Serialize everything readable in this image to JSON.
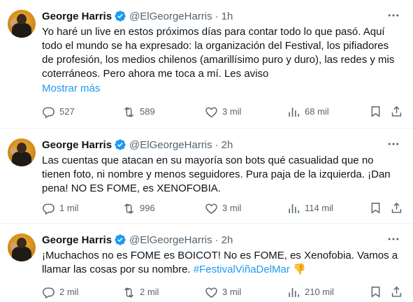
{
  "tweets": [
    {
      "name": "George Harris",
      "handle": "@ElGeorgeHarris",
      "separator": "·",
      "time": "1h",
      "text_lines": [
        "Yo haré un live en estos próximos días para contar todo lo que pasó. Aquí",
        "todo el mundo se ha expresado: la organización del Festival, los pifiadores",
        "de profesión, los medios chilenos (amarillísimo puro y duro), las redes y mis",
        "coterráneos. Pero ahora me toca a mí. Les aviso"
      ],
      "show_more": "Mostrar más",
      "replies": "527",
      "retweets": "589",
      "likes": "3 mil",
      "views": "68 mil"
    },
    {
      "name": "George Harris",
      "handle": "@ElGeorgeHarris",
      "separator": "·",
      "time": "2h",
      "text_lines": [
        "Las cuentas que atacan en su mayoría son bots qué casualidad que no",
        "tienen foto, ni nombre y menos seguidores. Pura paja de la izquierda. ¡Dan",
        "pena! NO ES FOME, es XENOFOBIA."
      ],
      "replies": "1 mil",
      "retweets": "996",
      "likes": "3 mil",
      "views": "114 mil"
    },
    {
      "name": "George Harris",
      "handle": "@ElGeorgeHarris",
      "separator": "·",
      "time": "2h",
      "text_lines": [
        "¡Muchachos no es FOME es BOICOT! No es FOME, es Xenofobia. Vamos a",
        "llamar las cosas por su nombre."
      ],
      "hashtag": "#FestivalViñaDelMar",
      "emoji": "👎",
      "replies": "2 mil",
      "retweets": "2 mil",
      "likes": "3 mil",
      "views": "210 mil"
    }
  ],
  "colors": {
    "accent": "#1d9bf0",
    "secondary_text": "#536471",
    "divider": "#eff3f4"
  },
  "icons": [
    "verified-badge-icon",
    "more-icon",
    "reply-icon",
    "retweet-icon",
    "like-icon",
    "views-icon",
    "bookmark-icon",
    "share-icon"
  ]
}
